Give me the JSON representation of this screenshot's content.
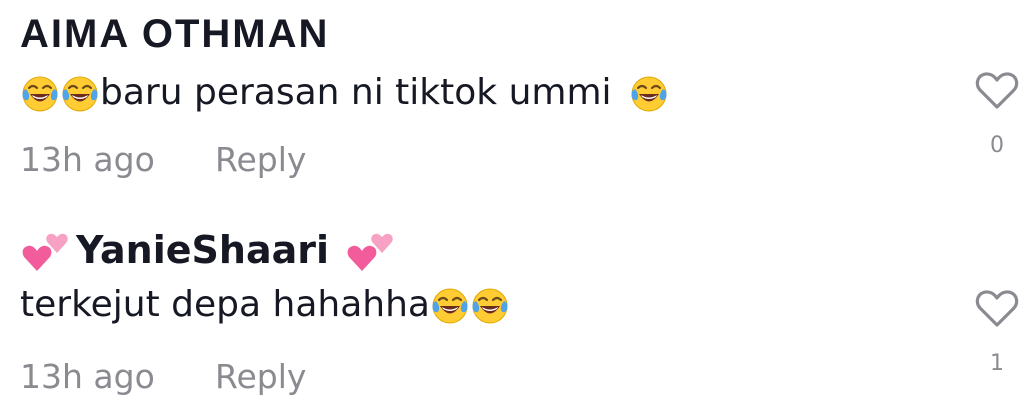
{
  "comments": [
    {
      "username": "AIMA OTHMAN",
      "text": "baru perasan ni tiktok ummi ",
      "time": "13h ago",
      "reply_label": "Reply",
      "like_count": "0",
      "icons": [
        "laughing-tears-emoji",
        "laughing-tears-emoji",
        "laughing-tears-emoji",
        "heart-outline-icon"
      ]
    },
    {
      "username": "YanieShaari",
      "text": "terkejut depa hahahha",
      "time": "13h ago",
      "reply_label": "Reply",
      "like_count": "1",
      "icons": [
        "two-hearts-emoji",
        "two-hearts-emoji",
        "laughing-tears-emoji",
        "laughing-tears-emoji",
        "heart-outline-icon"
      ]
    }
  ],
  "colors": {
    "text": "#161823",
    "muted": "#8a8b91",
    "emoji_face": "#FFCC33",
    "emoji_tears": "#4FA3E8",
    "pink_heart": "#F25C9A"
  }
}
